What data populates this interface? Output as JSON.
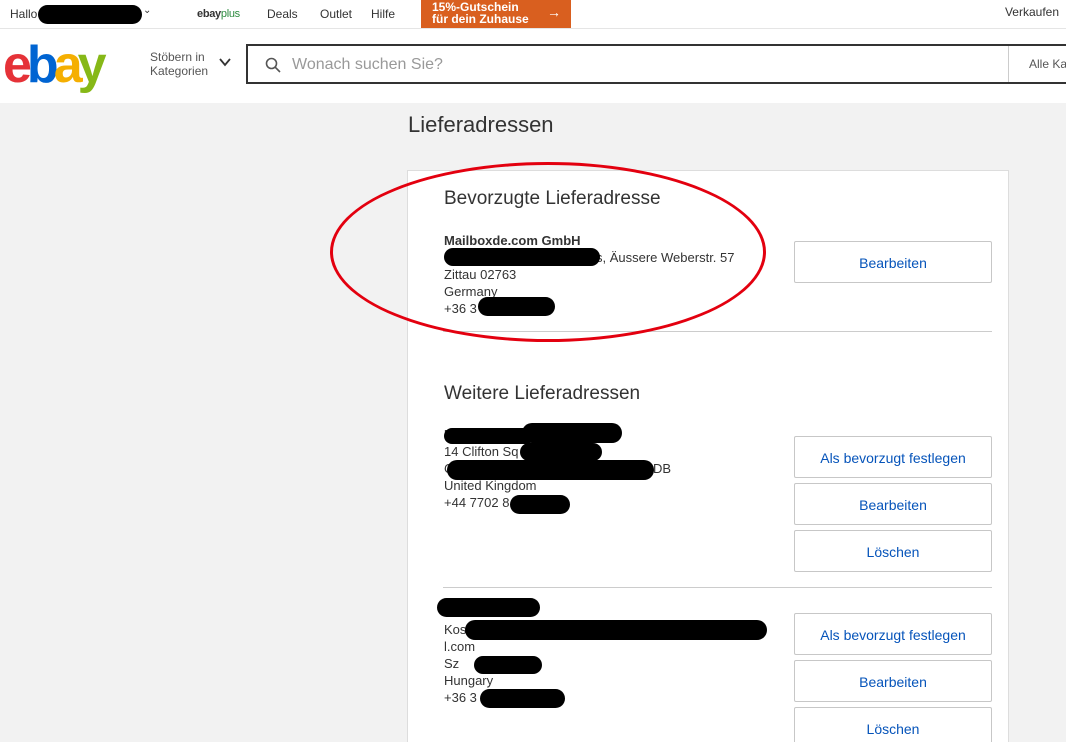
{
  "topbar": {
    "greeting": "Hallo",
    "ebay_plus_ebay": "ebay",
    "ebay_plus_plus": "plus",
    "deals": "Deals",
    "outlet": "Outlet",
    "hilfe": "Hilfe",
    "promo_line1": "15%-Gutschein",
    "promo_line2": "für dein Zuhause",
    "verkaufen": "Verkaufen"
  },
  "header": {
    "logo_e": "e",
    "logo_b": "b",
    "logo_a": "a",
    "logo_y": "y",
    "category_line1": "Stöbern in",
    "category_line2": "Kategorien",
    "search_placeholder": "Wonach suchen Sie?",
    "search_category": "Alle Ka"
  },
  "page_title": "Lieferadressen",
  "preferred": {
    "title": "Bevorzugte Lieferadresse",
    "name": "Mailboxde.com GmbH",
    "street_suffix": "s, Äussere Weberstr. 57",
    "city": "Zittau 02763",
    "country": "Germany",
    "phone": "+36 3",
    "edit_label": "Bearbeiten"
  },
  "others": {
    "title": "Weitere Lieferadressen",
    "addresses": [
      {
        "name": "L",
        "line1": "14 Clifton Sq",
        "line2_suffix": "DB",
        "line2_prefix": "C",
        "country": "United Kingdom",
        "phone": "+44 7702 8",
        "set_preferred_label": "Als bevorzugt festlegen",
        "edit_label": "Bearbeiten",
        "delete_label": "Löschen"
      },
      {
        "line1": "Kos",
        "line2": "l.com",
        "line3": "Sz",
        "country": "Hungary",
        "phone": "+36 3",
        "set_preferred_label": "Als bevorzugt festlegen",
        "edit_label": "Bearbeiten",
        "delete_label": "Löschen"
      }
    ]
  },
  "colors": {
    "link_blue": "#0654ba",
    "annotation_red": "#e3000f",
    "promo_orange": "#d95f1f"
  }
}
